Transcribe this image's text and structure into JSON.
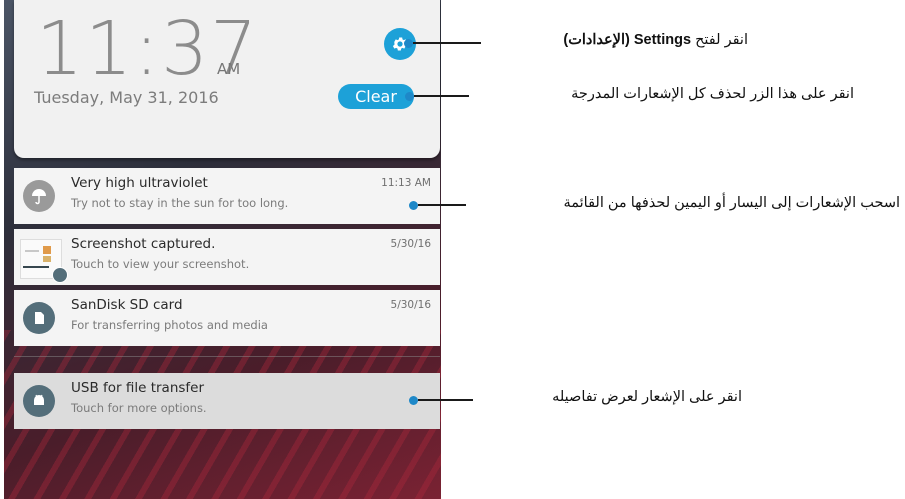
{
  "clock": {
    "time": "11:37",
    "ampm": "AM",
    "date": "Tuesday, May 31, 2016"
  },
  "buttons": {
    "clear_label": "Clear"
  },
  "notifications": [
    {
      "title": "Very high ultraviolet",
      "text": "Try not to stay in the sun for too long.",
      "time": "11:13 AM",
      "icon": "umbrella-icon",
      "icon_color": "#9a9a9a"
    },
    {
      "title": "Screenshot captured.",
      "text": "Touch to view your screenshot.",
      "time": "5/30/16",
      "icon": "screenshot-icon",
      "icon_color": "#546e7a"
    },
    {
      "title": "SanDisk SD card",
      "text": "For transferring photos and media",
      "time": "5/30/16",
      "icon": "sd-card-icon",
      "icon_color": "#546e7a"
    },
    {
      "title": "USB for file transfer",
      "text": "Touch for more options.",
      "time": "",
      "icon": "android-icon",
      "icon_color": "#546e7a"
    }
  ],
  "callouts": {
    "settings": {
      "prefix": "انقر لفتح ",
      "bold": "Settings (الإعدادات)"
    },
    "clear": "انقر على هذا الزر لحذف كل الإشعارات المدرجة",
    "swipe": "اسحب الإشعارات إلى اليسار أو اليمين لحذفها من القائمة",
    "details": "انقر على الإشعار لعرض تفاصيله"
  },
  "colors": {
    "accent": "#1da1d8",
    "pointer_dot": "#1e88c8"
  }
}
